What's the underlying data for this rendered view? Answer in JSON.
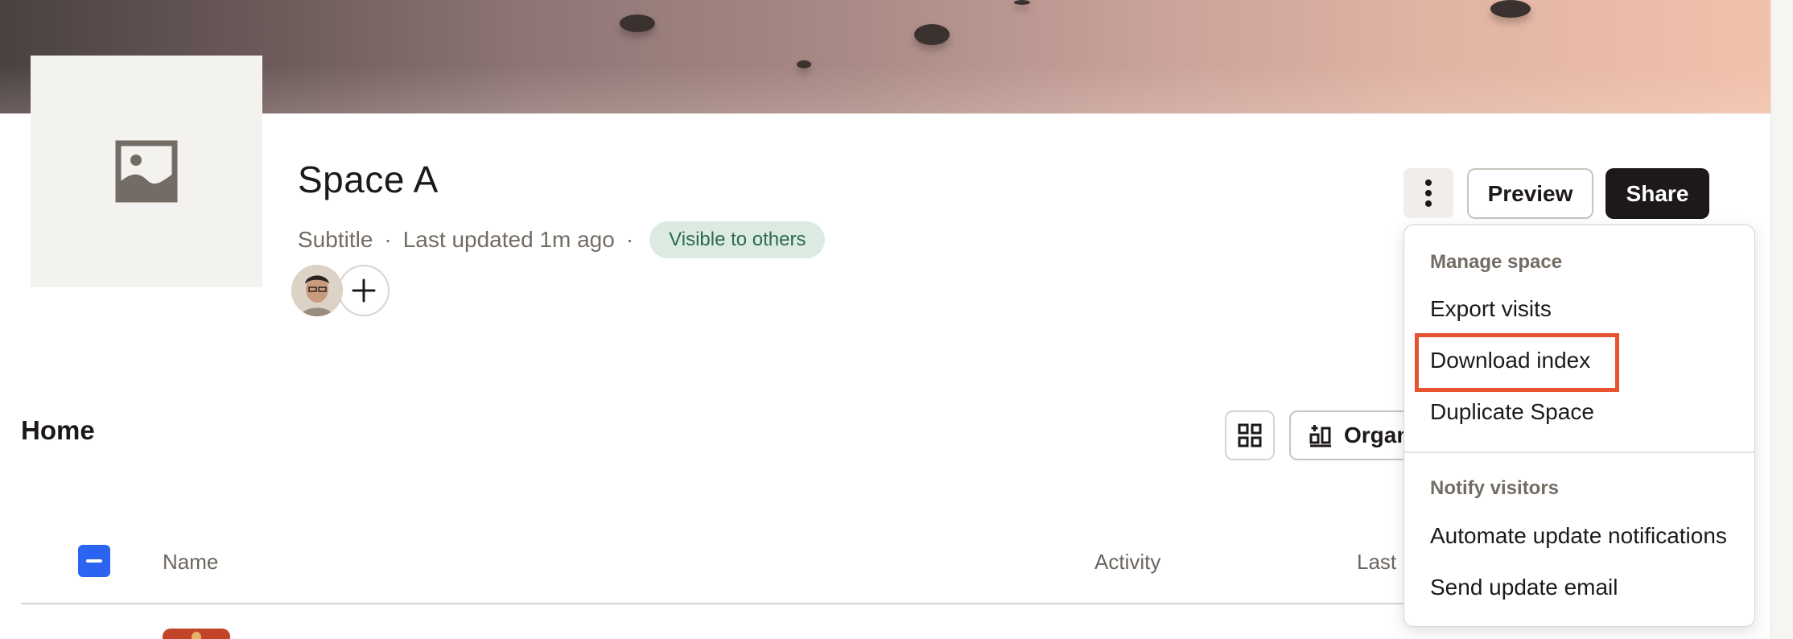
{
  "space": {
    "title": "Space A",
    "subtitle": "Subtitle",
    "separator": "·",
    "last_updated": "Last updated 1m ago",
    "visibility_badge": "Visible to others",
    "thumbnail_icon": "image-placeholder-icon",
    "members_avatar_icon": "avatar",
    "add_member_icon": "plus-icon"
  },
  "header_actions": {
    "more_icon": "more-vertical-icon",
    "preview_label": "Preview",
    "share_label": "Share"
  },
  "home": {
    "title": "Home",
    "grid_icon": "grid-icon",
    "organize_label": "Organize",
    "organize_icon": "organize-icon",
    "columns": [
      "Name",
      "Activity",
      "Last updated"
    ]
  },
  "menu": {
    "sections": [
      {
        "heading": "Manage space",
        "items": [
          "Export visits",
          "Download index",
          "Duplicate Space"
        ]
      },
      {
        "heading": "Notify visitors",
        "items": [
          "Automate update notifications",
          "Send update email"
        ]
      }
    ],
    "highlighted_item": "Download index"
  },
  "colors": {
    "primary_dark": "#1e1919",
    "accent_blue": "#2b64f0",
    "badge_bg": "#dcebe2",
    "badge_text": "#2e6a4c",
    "highlight": "#e7522f"
  }
}
